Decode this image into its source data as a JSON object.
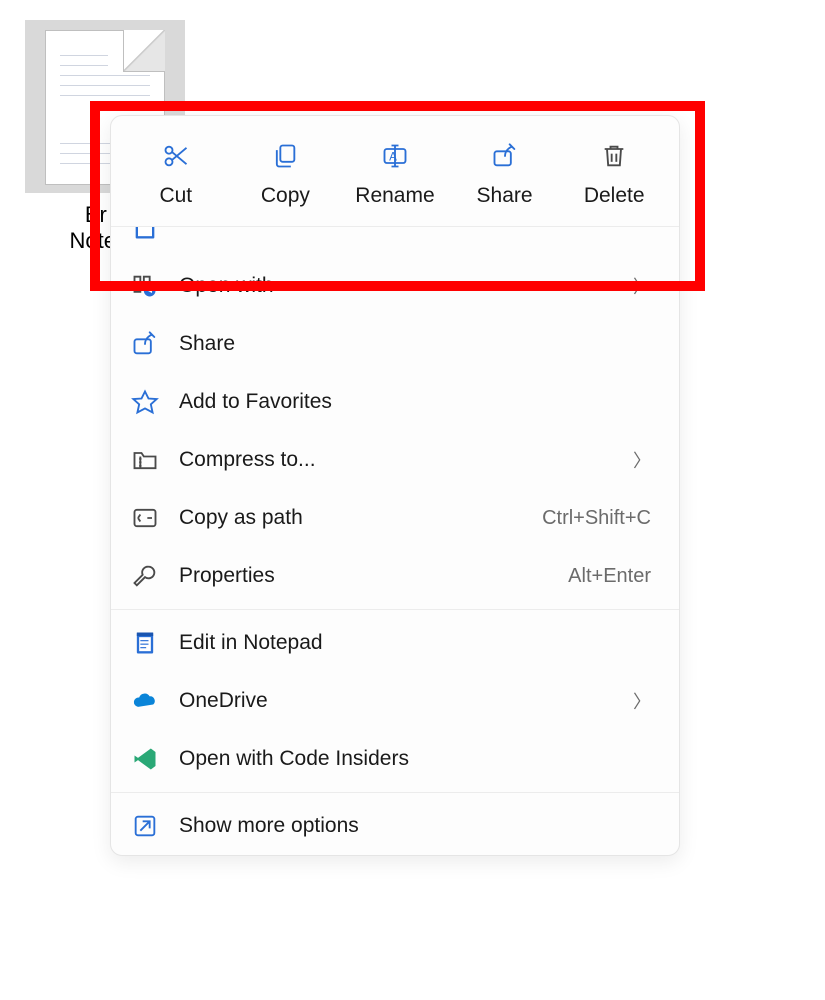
{
  "file": {
    "label": "Br n\nNotepa"
  },
  "context_menu": {
    "quick_actions": [
      {
        "name": "cut",
        "label": "Cut"
      },
      {
        "name": "copy",
        "label": "Copy"
      },
      {
        "name": "rename",
        "label": "Rename"
      },
      {
        "name": "share",
        "label": "Share"
      },
      {
        "name": "delete",
        "label": "Delete"
      }
    ],
    "items": [
      {
        "name": "open-with",
        "label": "Open with",
        "shortcut": "",
        "submenu": true
      },
      {
        "name": "share",
        "label": "Share",
        "shortcut": "",
        "submenu": false
      },
      {
        "name": "favorites",
        "label": "Add to Favorites",
        "shortcut": "",
        "submenu": false
      },
      {
        "name": "compress",
        "label": "Compress to...",
        "shortcut": "",
        "submenu": true
      },
      {
        "name": "copy-path",
        "label": "Copy as path",
        "shortcut": "Ctrl+Shift+C",
        "submenu": false
      },
      {
        "name": "properties",
        "label": "Properties",
        "shortcut": "Alt+Enter",
        "submenu": false
      }
    ],
    "items2": [
      {
        "name": "edit-notepad",
        "label": "Edit in Notepad",
        "shortcut": "",
        "submenu": false
      },
      {
        "name": "onedrive",
        "label": "OneDrive",
        "shortcut": "",
        "submenu": true
      },
      {
        "name": "code-insiders",
        "label": "Open with Code Insiders",
        "shortcut": "",
        "submenu": false
      }
    ],
    "show_more": "Show more options"
  }
}
